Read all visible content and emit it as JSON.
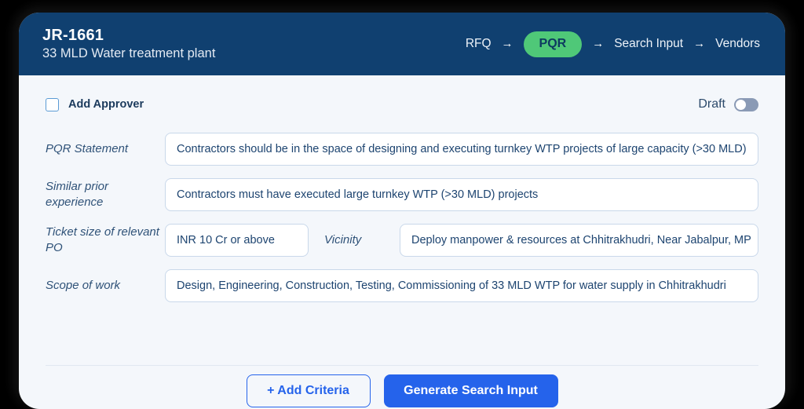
{
  "header": {
    "job_id": "JR-1661",
    "subtitle": "33 MLD Water treatment plant",
    "breadcrumb": [
      {
        "label": "RFQ",
        "active": false
      },
      {
        "label": "PQR",
        "active": true
      },
      {
        "label": "Search Input",
        "active": false
      },
      {
        "label": "Vendors",
        "active": false
      }
    ],
    "arrow_glyph": "→",
    "colors": {
      "band": "#104070",
      "active_pill": "#4fc878",
      "active_pill_text": "#0d3b60"
    }
  },
  "toolbar": {
    "add_approver_label": "Add Approver",
    "add_approver_checked": false,
    "draft_label": "Draft",
    "draft_toggle_on": false
  },
  "form": {
    "pqr_statement": {
      "label": "PQR Statement",
      "value": "Contractors should be in the space of designing and executing turnkey WTP projects of large capacity (>30 MLD)"
    },
    "similar_prior_experience": {
      "label": "Similar prior experience",
      "value": "Contractors must have executed large turnkey WTP (>30 MLD) projects"
    },
    "ticket_size": {
      "label": "Ticket size of relevant PO",
      "value": "INR 10 Cr or above"
    },
    "vicinity": {
      "label": "Vicinity",
      "value": "Deploy manpower & resources at Chhitrakhudri, Near Jabalpur, MP"
    },
    "scope_of_work": {
      "label": "Scope of work",
      "value": "Design, Engineering, Construction, Testing, Commissioning of 33 MLD WTP for water supply in Chhitrakhudri"
    }
  },
  "footer": {
    "add_criteria_label": "+ Add Criteria",
    "generate_label": "Generate Search Input",
    "primary_color": "#2563eb"
  }
}
